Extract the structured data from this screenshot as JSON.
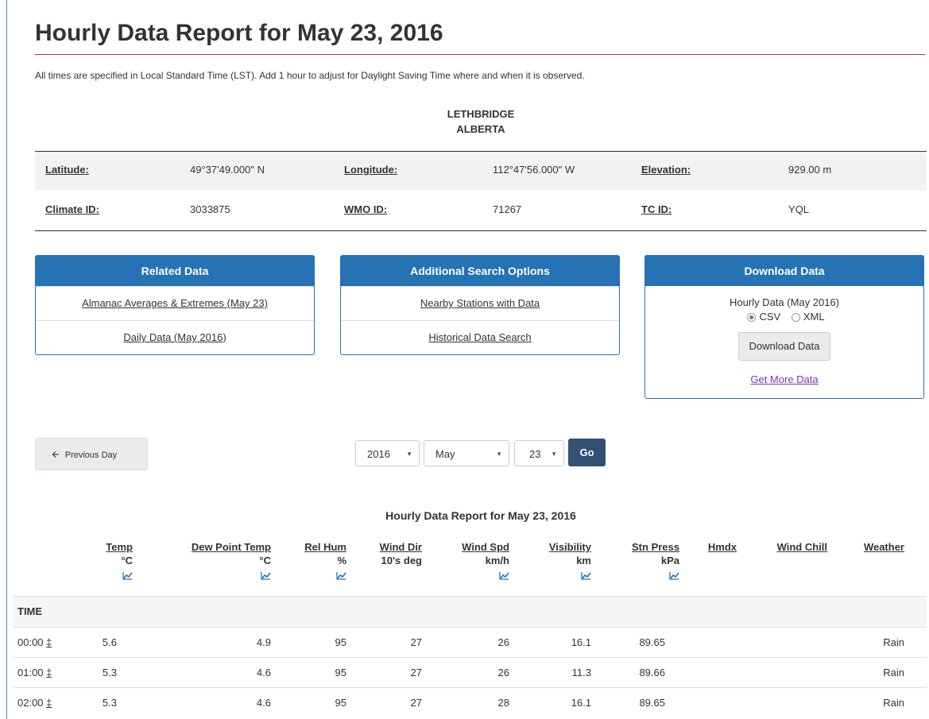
{
  "page": {
    "title": "Hourly Data Report for May 23, 2016",
    "note": "All times are specified in Local Standard Time (LST). Add 1 hour to adjust for Daylight Saving Time where and when it is observed.",
    "station_name": "LETHBRIDGE",
    "province": "ALBERTA"
  },
  "meta": {
    "latitude_label": "Latitude:",
    "latitude": "49°37'49.000\" N",
    "longitude_label": "Longitude:",
    "longitude": "112°47'56.000\" W",
    "elevation_label": "Elevation:",
    "elevation": "929.00 m",
    "climate_id_label": "Climate ID:",
    "climate_id": "3033875",
    "wmo_id_label": "WMO ID:",
    "wmo_id": "71267",
    "tc_id_label": "TC ID:",
    "tc_id": "YQL"
  },
  "related": {
    "heading": "Related Data",
    "links": [
      "Almanac Averages & Extremes (May 23)",
      "Daily Data (May 2016)"
    ]
  },
  "search": {
    "heading": "Additional Search Options",
    "links": [
      "Nearby Stations with Data",
      "Historical Data Search"
    ]
  },
  "download": {
    "heading": "Download Data",
    "label": "Hourly Data (May 2016)",
    "opt_csv": "CSV",
    "opt_xml": "XML",
    "selected": "CSV",
    "button": "Download Data",
    "more": "Get More Data"
  },
  "nav": {
    "prev": "Previous Day",
    "year": "2016",
    "month": "May",
    "day": "23",
    "go": "Go"
  },
  "table": {
    "caption": "Hourly Data Report for May 23, 2016",
    "headers": [
      {
        "name": "Temp",
        "unit": "°C",
        "trend": true
      },
      {
        "name": "Dew Point Temp",
        "unit": "°C",
        "trend": true
      },
      {
        "name": "Rel Hum",
        "unit": "%",
        "trend": true
      },
      {
        "name": "Wind Dir",
        "unit": "10's deg",
        "trend": false
      },
      {
        "name": "Wind Spd",
        "unit": "km/h",
        "trend": true
      },
      {
        "name": "Visibility",
        "unit": "km",
        "trend": true
      },
      {
        "name": "Stn Press",
        "unit": "kPa",
        "trend": true
      },
      {
        "name": "Hmdx",
        "unit": "",
        "trend": false
      },
      {
        "name": "Wind Chill",
        "unit": "",
        "trend": false
      },
      {
        "name": "Weather",
        "unit": "",
        "trend": false
      }
    ],
    "time_label": "TIME",
    "flag": "‡",
    "rows": [
      {
        "time": "00:00",
        "temp": "5.6",
        "dew": "4.9",
        "hum": "95",
        "dir": "27",
        "spd": "26",
        "vis": "16.1",
        "press": "89.65",
        "hmdx": "",
        "chill": "",
        "weather": "Rain"
      },
      {
        "time": "01:00",
        "temp": "5.3",
        "dew": "4.6",
        "hum": "95",
        "dir": "27",
        "spd": "26",
        "vis": "11.3",
        "press": "89.66",
        "hmdx": "",
        "chill": "",
        "weather": "Rain"
      },
      {
        "time": "02:00",
        "temp": "5.3",
        "dew": "4.6",
        "hum": "95",
        "dir": "27",
        "spd": "28",
        "vis": "16.1",
        "press": "89.65",
        "hmdx": "",
        "chill": "",
        "weather": "Rain"
      }
    ]
  },
  "colors": {
    "panel_blue": "#2572b4",
    "go_navy": "#335075",
    "rule_red": "#af3c43",
    "visited_link": "#7834bc"
  }
}
